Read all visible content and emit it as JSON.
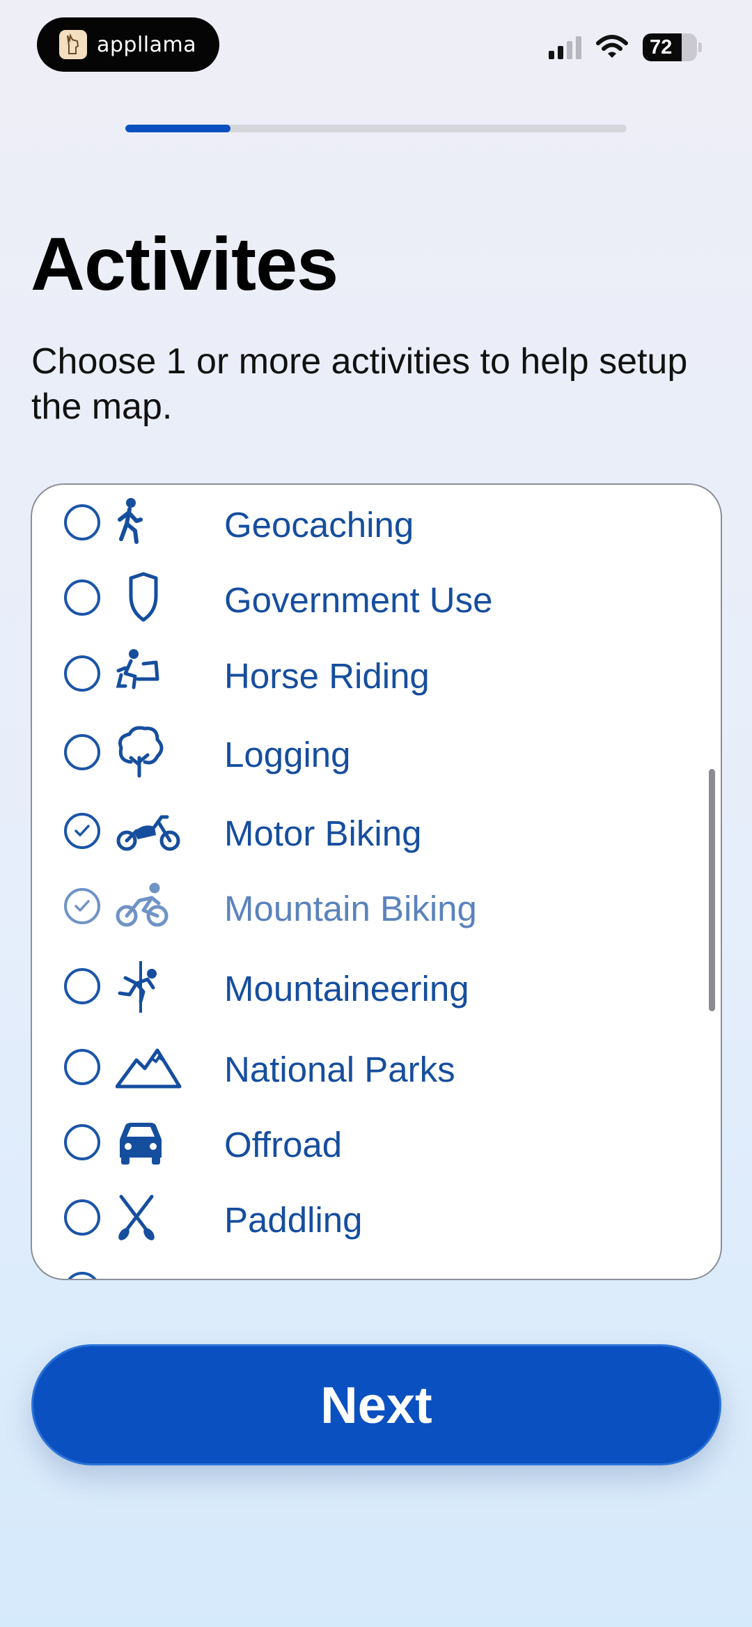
{
  "status_bar": {
    "app_badge_label": "appllama",
    "battery_level": "72",
    "signal_bars_filled": 2,
    "signal_bars_total": 4
  },
  "progress": {
    "fraction": 0.21
  },
  "page": {
    "title": "Activites",
    "subtitle": "Choose 1 or more activities to help setup the map."
  },
  "activities": [
    {
      "label": "Geocaching",
      "icon": "hiker-icon",
      "selected": false
    },
    {
      "label": "Government Use",
      "icon": "shield-icon",
      "selected": false
    },
    {
      "label": "Horse Riding",
      "icon": "horse-rider-icon",
      "selected": false
    },
    {
      "label": "Logging",
      "icon": "tree-icon",
      "selected": false
    },
    {
      "label": "Motor Biking",
      "icon": "motorbike-icon",
      "selected": true
    },
    {
      "label": "Mountain Biking",
      "icon": "bicycle-icon",
      "selected": true
    },
    {
      "label": "Mountaineering",
      "icon": "climber-icon",
      "selected": false
    },
    {
      "label": "National Parks",
      "icon": "mountains-icon",
      "selected": false
    },
    {
      "label": "Offroad",
      "icon": "car-icon",
      "selected": false
    },
    {
      "label": "Paddling",
      "icon": "crossed-paddles-icon",
      "selected": false
    }
  ],
  "next_button": {
    "label": "Next"
  },
  "colors": {
    "accent": "#0b50c0",
    "label": "#164e9e"
  }
}
